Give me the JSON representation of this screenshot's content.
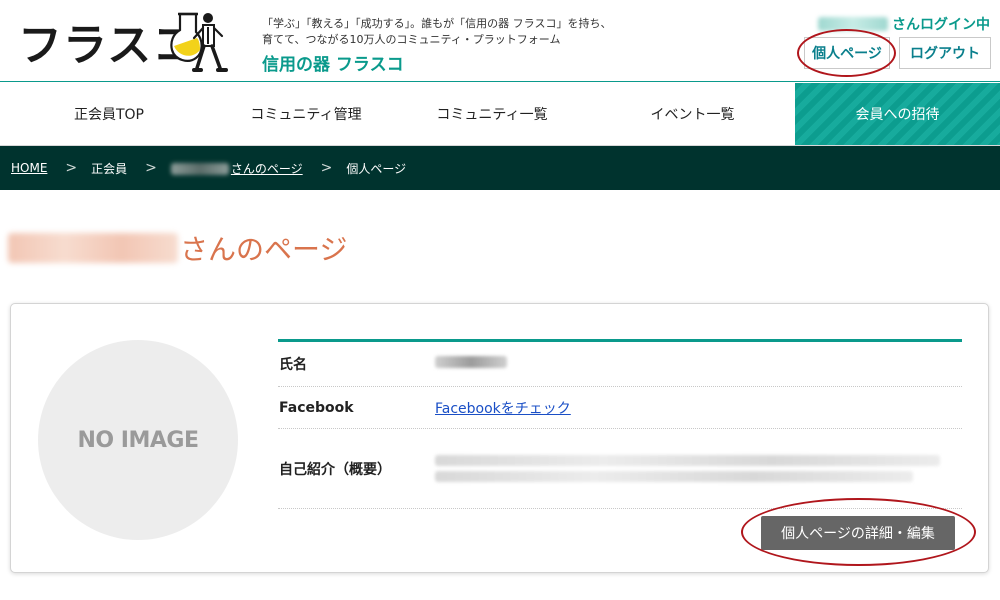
{
  "header": {
    "logo_text": "フラスコ",
    "tagline": "「学ぶ」「教える」「成功する」。誰もが「信用の器 フラスコ」を持ち、育てて、つながる10万人のコミュニティ・プラットフォーム",
    "brand_name": "信用の器 フラスコ",
    "login_status": "さんログイン中",
    "mypage_label": "個人ページ",
    "logout_label": "ログアウト"
  },
  "nav": {
    "items": [
      {
        "label": "正会員TOP"
      },
      {
        "label": "コミュニティ管理"
      },
      {
        "label": "コミュニティ一覧"
      },
      {
        "label": "イベント一覧"
      },
      {
        "label": "会員への招待"
      }
    ]
  },
  "breadcrumb": {
    "home": "HOME",
    "member": "正会員",
    "user_page": "さんのページ",
    "current": "個人ページ",
    "separator": ">"
  },
  "page": {
    "title_suffix": "さんのページ"
  },
  "profile": {
    "avatar_text": "NO IMAGE",
    "name_label": "氏名",
    "facebook_label": "Facebook",
    "facebook_link": "Facebookをチェック",
    "intro_label": "自己紹介（概要）",
    "edit_button": "個人ページの詳細・編集"
  },
  "colors": {
    "brand": "#0a9a8c",
    "breadcrumb_bg": "#00332e",
    "title": "#d9744d",
    "highlight_ring": "#b0161c",
    "edit_button": "#666666",
    "link": "#1a4fc6"
  },
  "icons": {
    "logo": "flask-character-icon"
  }
}
